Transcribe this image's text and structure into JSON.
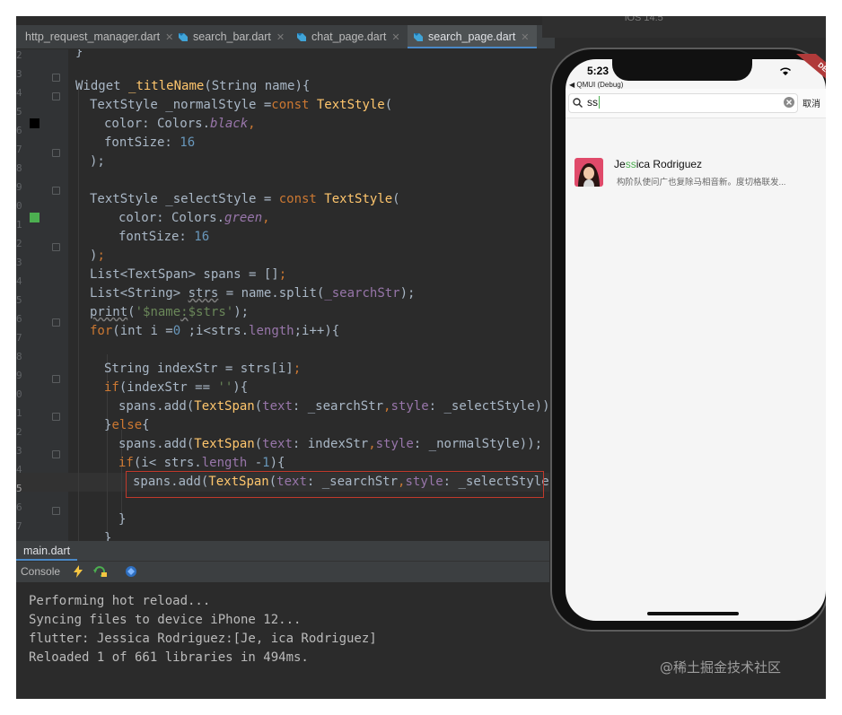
{
  "tabs": [
    {
      "label": "http_request_manager.dart",
      "active": false
    },
    {
      "label": "search_bar.dart",
      "active": false
    },
    {
      "label": "chat_page.dart",
      "active": false
    },
    {
      "label": "search_page.dart",
      "active": true
    }
  ],
  "gutter_numbers": [
    "2",
    "3",
    "4",
    "5",
    "6",
    "7",
    "8",
    "9",
    "0",
    "1",
    "2",
    "3",
    "4",
    "5",
    "6",
    "7",
    "8",
    "9",
    "0",
    "1",
    "2",
    "3",
    "4",
    "5",
    "6",
    "7"
  ],
  "code": {
    "l0": "}",
    "l1_a": "Widget ",
    "l1_b": "_titleName",
    "l1_c": "(String name){",
    "l2_a": "TextStyle _normalStyle =",
    "l2_b": "const ",
    "l2_c": "TextStyle",
    "l2_d": "(",
    "l3_a": "color: Colors.",
    "l3_b": "black",
    "l3_c": ",",
    "l4_a": "fontSize: ",
    "l4_b": "16",
    "l5": ");",
    "l7_a": "TextStyle _selectStyle = ",
    "l7_b": "const ",
    "l7_c": "TextStyle",
    "l7_d": "(",
    "l8_a": "color: Colors.",
    "l8_b": "green",
    "l8_c": ",",
    "l9_a": "fontSize: ",
    "l9_b": "16",
    "l10_a": ")",
    "l10_b": ";",
    "l11_a": "List<TextSpan> spans = []",
    "l11_b": ";",
    "l12_a": "List<String> ",
    "l12_b": "strs",
    "l12_c": " = name.split(",
    "l12_d": "_searchStr",
    "l12_e": ");",
    "l13_a": "print",
    "l13_b": "(",
    "l13_c": "'$name",
    "l13_d": ":",
    "l13_e": "$strs'",
    "l13_f": ");",
    "l14_a": "for",
    "l14_b": "(int i =",
    "l14_c": "0",
    "l14_d": " ;i<strs.",
    "l14_e": "length",
    "l14_f": ";i++){",
    "l16_a": "String indexStr = strs[i]",
    "l16_b": ";",
    "l17_a": "if",
    "l17_b": "(indexStr == ",
    "l17_c": "''",
    "l17_d": "){",
    "l18_a": "spans.add(",
    "l18_b": "TextSpan",
    "l18_c": "(",
    "l18_d": "text",
    "l18_e": ": _searchStr",
    "l18_f": ",",
    "l18_g": "style",
    "l18_h": ": _selectStyle));",
    "l19_a": "}",
    "l19_b": "else",
    "l19_c": "{",
    "l20_a": "spans.add(",
    "l20_b": "TextSpan",
    "l20_c": "(",
    "l20_d": "text",
    "l20_e": ": indexStr",
    "l20_f": ",",
    "l20_g": "style",
    "l20_h": ": _normalStyle));",
    "l21_a": "if",
    "l21_b": "(i< strs.",
    "l21_c": "length",
    "l21_d": " -",
    "l21_e": "1",
    "l21_f": "){",
    "l22_a": "spans.add(",
    "l22_b": "TextSpan",
    "l22_c": "(",
    "l22_d": "text",
    "l22_e": ": _searchStr",
    "l22_f": ",",
    "l22_g": "style",
    "l22_h": ": _selectStyle));",
    "l24": "}",
    "l25": "}"
  },
  "run": {
    "tab_label": "main.dart",
    "console_label": "Console"
  },
  "console_lines": [
    "Performing hot reload...",
    "Syncing files to device iPhone 12...",
    "flutter: Jessica Rodriguez:[Je, ica Rodriguez]",
    "Reloaded 1 of 661 libraries in 494ms."
  ],
  "simulator": {
    "title": "iOS 14.5",
    "time": "5:23",
    "back_label": "◀ QMUI (Debug)",
    "ribbon": "DEBUG",
    "search_value": "ss",
    "cancel_label": "取消",
    "result": {
      "name_pre": "Je",
      "name_match": "ss",
      "name_post": "ica Rodriguez",
      "subtitle": "构阶队使问广也复除马相音新。度切格联发..."
    }
  },
  "watermark": "@稀土掘金技术社区",
  "colors": {
    "keyword": "#cc7832",
    "type": "#ffc66d",
    "number": "#6897bb",
    "property": "#9876aa",
    "string": "#6a8759",
    "highlight_box": "#c0392b",
    "match": "#4caf50"
  }
}
